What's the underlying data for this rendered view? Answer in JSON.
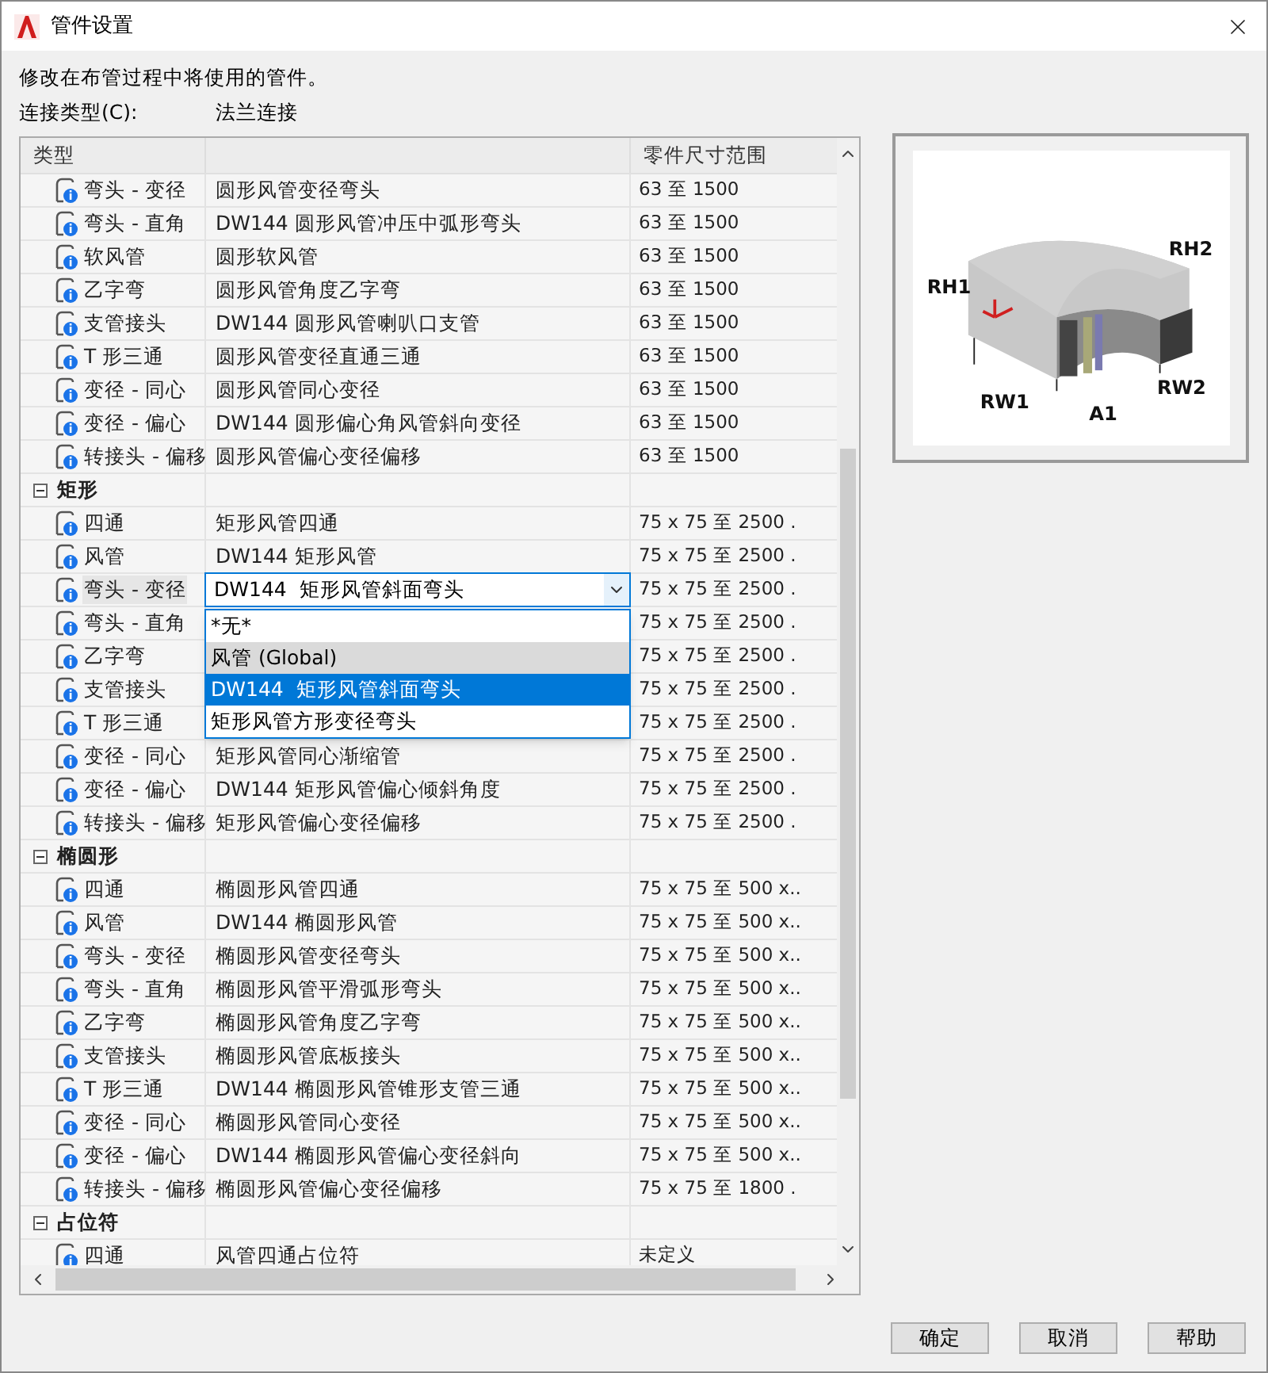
{
  "window": {
    "title": "管件设置"
  },
  "description": "修改在布管过程中将使用的管件。",
  "connection_type": {
    "label": "连接类型(C):",
    "value": "法兰连接"
  },
  "table": {
    "headers": {
      "type": "类型",
      "size": "零件尺寸范围"
    },
    "groups": [
      {
        "items": [
          {
            "type": "弯头 - 变径",
            "fitting": "圆形风管变径弯头",
            "size": "63 至 1500"
          },
          {
            "type": "弯头 - 直角",
            "fitting": "DW144 圆形风管冲压中弧形弯头",
            "size": "63 至 1500"
          },
          {
            "type": "软风管",
            "fitting": "圆形软风管",
            "size": "63 至 1500"
          },
          {
            "type": "乙字弯",
            "fitting": "圆形风管角度乙字弯",
            "size": "63 至 1500"
          },
          {
            "type": "支管接头",
            "fitting": "DW144 圆形风管喇叭口支管",
            "size": "63 至 1500"
          },
          {
            "type": "T 形三通",
            "fitting": "圆形风管变径直通三通",
            "size": "63 至 1500"
          },
          {
            "type": "变径 - 同心",
            "fitting": "圆形风管同心变径",
            "size": "63 至 1500"
          },
          {
            "type": "变径 - 偏心",
            "fitting": "DW144 圆形偏心角风管斜向变径",
            "size": "63 至 1500"
          },
          {
            "type": "转接头 - 偏移",
            "fitting": "圆形风管偏心变径偏移",
            "size": "63 至 1500"
          }
        ]
      },
      {
        "name": "矩形",
        "expanded": true,
        "items": [
          {
            "type": "四通",
            "fitting": "矩形风管四通",
            "size": "75 x 75 至 2500 ."
          },
          {
            "type": "风管",
            "fitting": "DW144 矩形风管",
            "size": "75 x 75 至 2500 ."
          },
          {
            "type": "弯头 - 变径",
            "kind": "combo",
            "fitting": "DW144  矩形风管斜面弯头",
            "size": "75 x 75 至 2500 .",
            "options": [
              {
                "label": "*无*",
                "selected": false,
                "hovered": false
              },
              {
                "label": "风管 (Global)",
                "selected": false,
                "hovered": true
              },
              {
                "label": "DW144  矩形风管斜面弯头",
                "selected": true,
                "hovered": false
              },
              {
                "label": "矩形风管方形变径弯头",
                "selected": false,
                "hovered": false
              }
            ]
          },
          {
            "type": "弯头 - 直角",
            "size": "75 x 75 至 2500 ."
          },
          {
            "type": "乙字弯",
            "size": "75 x 75 至 2500 ."
          },
          {
            "type": "支管接头",
            "size": "75 x 75 至 2500 ."
          },
          {
            "type": "T 形三通",
            "size": "75 x 75 至 2500 ."
          },
          {
            "type": "变径 - 同心",
            "fitting": "矩形风管同心渐缩管",
            "size": "75 x 75 至 2500 ."
          },
          {
            "type": "变径 - 偏心",
            "fitting": "DW144 矩形风管偏心倾斜角度",
            "size": "75 x 75 至 2500 ."
          },
          {
            "type": "转接头 - 偏移",
            "fitting": "矩形风管偏心变径偏移",
            "size": "75 x 75 至 2500 ."
          }
        ]
      },
      {
        "name": "椭圆形",
        "expanded": true,
        "items": [
          {
            "type": "四通",
            "fitting": "椭圆形风管四通",
            "size": "75 x 75 至 500 x.."
          },
          {
            "type": "风管",
            "fitting": "DW144 椭圆形风管",
            "size": "75 x 75 至 500 x.."
          },
          {
            "type": "弯头 - 变径",
            "fitting": "椭圆形风管变径弯头",
            "size": "75 x 75 至 500 x.."
          },
          {
            "type": "弯头 - 直角",
            "fitting": "椭圆形风管平滑弧形弯头",
            "size": "75 x 75 至 500 x.."
          },
          {
            "type": "乙字弯",
            "fitting": "椭圆形风管角度乙字弯",
            "size": "75 x 75 至 500 x.."
          },
          {
            "type": "支管接头",
            "fitting": "椭圆形风管底板接头",
            "size": "75 x 75 至 500 x.."
          },
          {
            "type": "T 形三通",
            "fitting": "DW144 椭圆形风管锥形支管三通",
            "size": "75 x 75 至 500 x.."
          },
          {
            "type": "变径 - 同心",
            "fitting": "椭圆形风管同心变径",
            "size": "75 x 75 至 500 x.."
          },
          {
            "type": "变径 - 偏心",
            "fitting": "DW144 椭圆形风管偏心变径斜向",
            "size": "75 x 75 至 500 x.."
          },
          {
            "type": "转接头 - 偏移",
            "fitting": "椭圆形风管偏心变径偏移",
            "size": "75 x 75 至 1800 ."
          }
        ]
      },
      {
        "name": "占位符",
        "expanded": true,
        "items": [
          {
            "type": "四通",
            "fitting": "风管四通占位符",
            "size": "未定义"
          }
        ]
      }
    ]
  },
  "preview": {
    "labels": [
      "RH1",
      "RH2",
      "A1",
      "RW1",
      "RW2"
    ]
  },
  "buttons": [
    "确定",
    "取消",
    "帮助"
  ]
}
